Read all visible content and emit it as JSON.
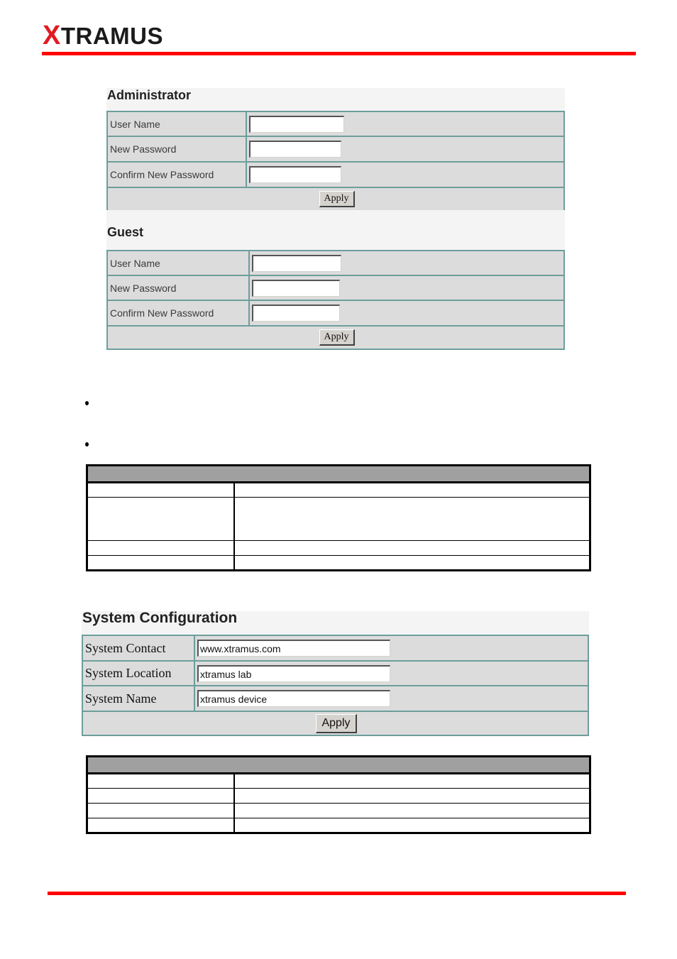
{
  "header": {
    "logo_x": "X",
    "logo_rest": "TRAMUS",
    "brand_color": "#ff0000"
  },
  "admin_panel": {
    "title": "Administrator",
    "rows": [
      {
        "label": "User Name",
        "value": ""
      },
      {
        "label": "New Password",
        "value": ""
      },
      {
        "label": "Confirm New Password",
        "value": ""
      }
    ],
    "apply_label": "Apply"
  },
  "guest_panel": {
    "title": "Guest",
    "rows": [
      {
        "label": "User Name",
        "value": ""
      },
      {
        "label": "New Password",
        "value": ""
      },
      {
        "label": "Confirm New Password",
        "value": ""
      }
    ],
    "apply_label": "Apply"
  },
  "bullets": [
    "",
    ""
  ],
  "table1": {
    "header": "",
    "rows": [
      [
        "",
        ""
      ],
      [
        "",
        ""
      ],
      [
        "",
        ""
      ],
      [
        "",
        ""
      ]
    ]
  },
  "system_config": {
    "title": "System Configuration",
    "rows": [
      {
        "label": "System Contact",
        "value": "www.xtramus.com"
      },
      {
        "label": "System Location",
        "value": "xtramus lab"
      },
      {
        "label": "System Name",
        "value": "xtramus device"
      }
    ],
    "apply_label": "Apply"
  },
  "table2": {
    "header": "",
    "rows": [
      [
        "",
        ""
      ],
      [
        "",
        ""
      ],
      [
        "",
        ""
      ],
      [
        "",
        ""
      ]
    ]
  }
}
